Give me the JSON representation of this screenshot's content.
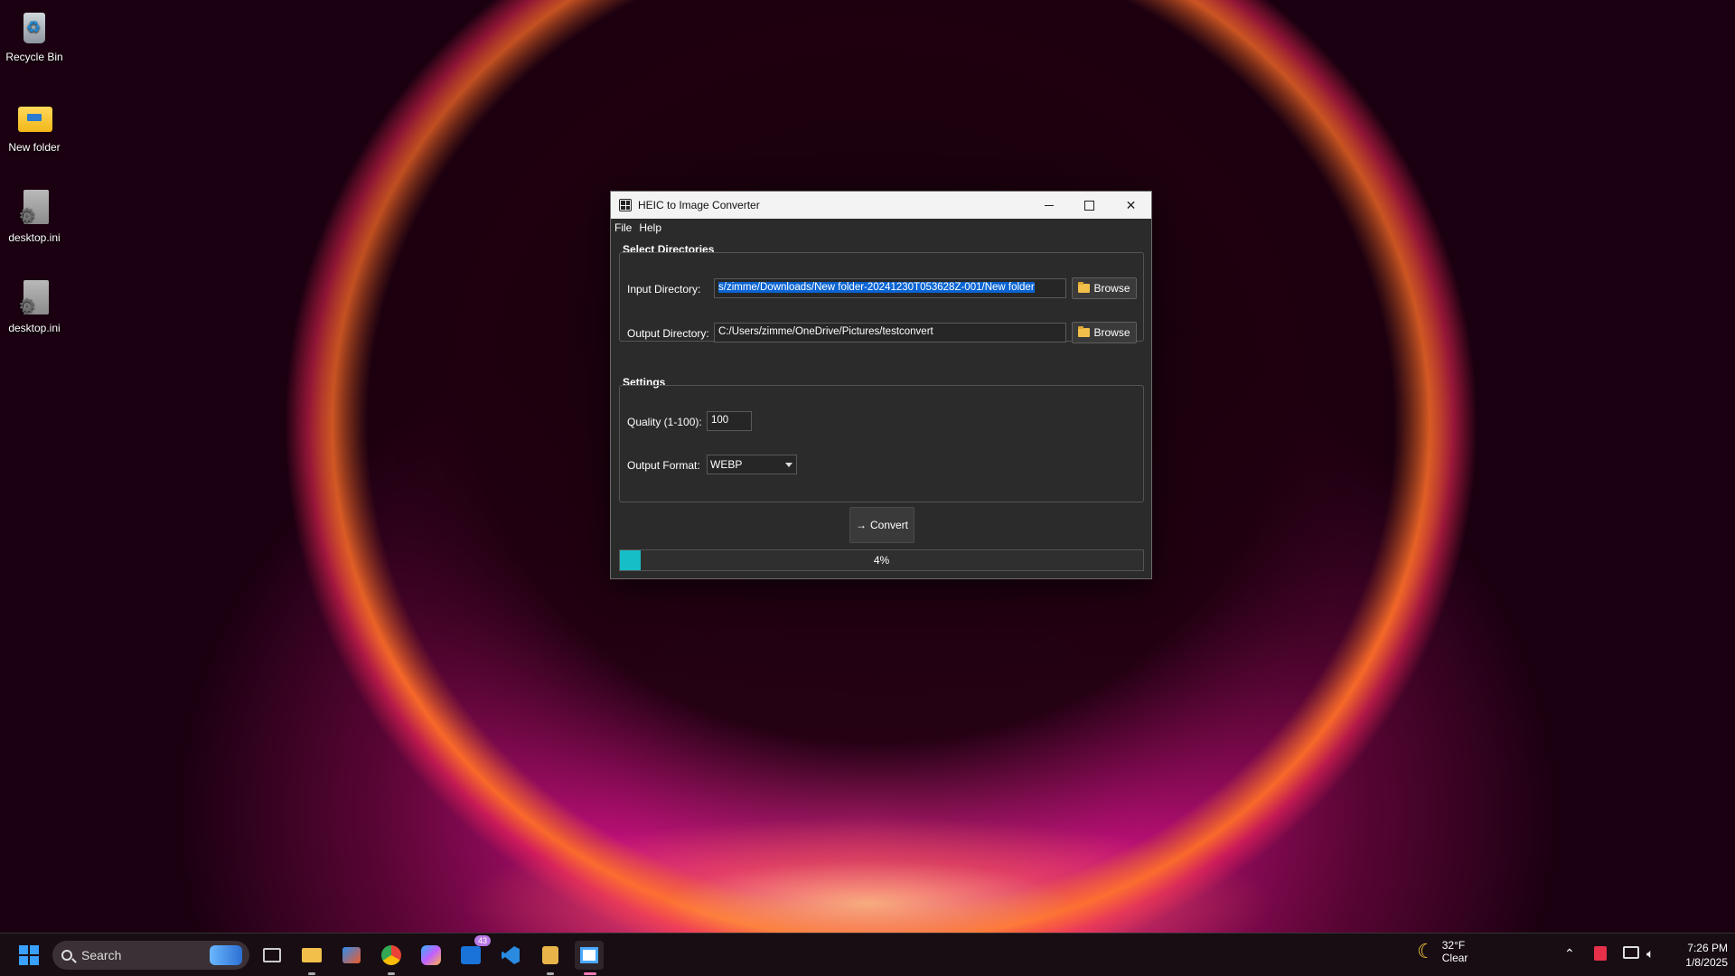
{
  "desktop": {
    "icons": [
      {
        "label": "Recycle Bin",
        "icon": "recycle-bin-icon"
      },
      {
        "label": "New folder",
        "icon": "folder-icon"
      },
      {
        "label": "desktop.ini",
        "icon": "settings-file-icon"
      },
      {
        "label": "desktop.ini",
        "icon": "settings-file-icon"
      }
    ]
  },
  "window": {
    "title": "HEIC to Image Converter",
    "menu": [
      "File",
      "Help"
    ],
    "directories": {
      "group_label": "Select Directories",
      "input_label": "Input Directory:",
      "input_value": "s/zimme/Downloads/New folder-20241230T053628Z-001/New folder",
      "output_label": "Output Directory:",
      "output_value": "C:/Users/zimme/OneDrive/Pictures/testconvert",
      "browse_label": "Browse"
    },
    "settings": {
      "group_label": "Settings",
      "quality_label": "Quality (1-100):",
      "quality_value": "100",
      "format_label": "Output Format:",
      "format_value": "WEBP"
    },
    "convert_label": "Convert",
    "progress": {
      "fraction": 0.04,
      "label": "4%"
    },
    "colors": {
      "progress_fill": "#16bec8",
      "selection": "#0a64d2"
    }
  },
  "taskbar": {
    "search_placeholder": "Search",
    "badge_count": "43",
    "weather": {
      "temp": "32°F",
      "condition": "Clear"
    },
    "clock": {
      "time": "7:26 PM",
      "date": "1/8/2025"
    }
  }
}
